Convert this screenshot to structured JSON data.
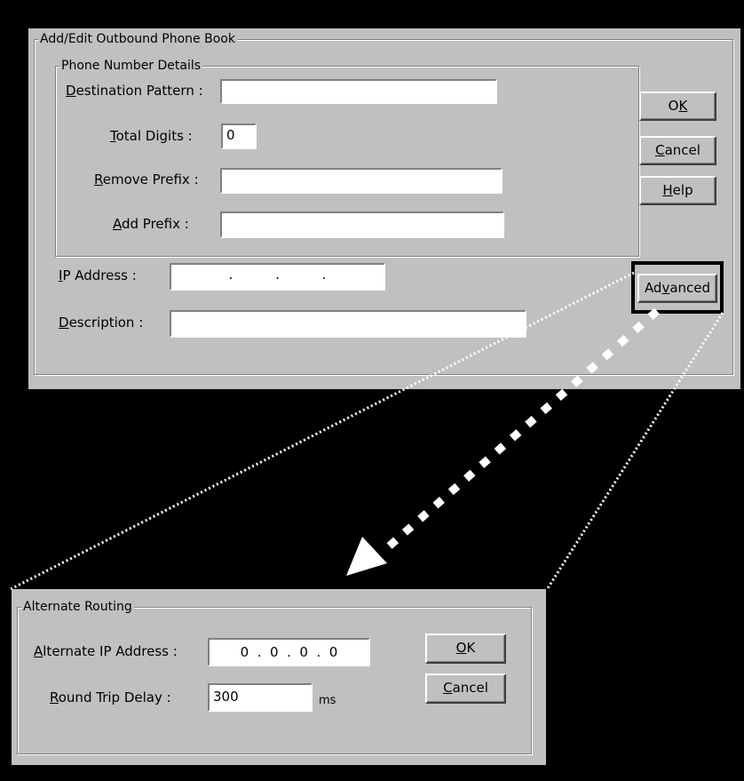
{
  "main_dialog": {
    "group_title": "Add/Edit Outbound Phone Book",
    "phone_group_title": "Phone Number Details",
    "destination_pattern": {
      "label_key": "D",
      "label_rest": "estination Pattern :",
      "value": ""
    },
    "total_digits": {
      "label_key": "T",
      "label_rest": "otal Digits :",
      "value": "0"
    },
    "remove_prefix": {
      "label_key": "R",
      "label_rest": "emove Prefix :",
      "value": ""
    },
    "add_prefix": {
      "label_key": "A",
      "label_rest": "dd Prefix :",
      "value": ""
    },
    "ip_address": {
      "label_key": "I",
      "label_rest": "P Address :",
      "value": ".          .          ."
    },
    "description": {
      "label_key": "D",
      "label_rest": "escription :",
      "value": ""
    },
    "ok": {
      "pre": "O",
      "key": "K",
      "post": ""
    },
    "cancel": {
      "pre": "",
      "key": "C",
      "post": "ancel"
    },
    "help": {
      "pre": "",
      "key": "H",
      "post": "elp"
    },
    "advanced": {
      "pre": "Ad",
      "key": "v",
      "post": "anced"
    }
  },
  "alt_dialog": {
    "group_title": "Alternate Routing",
    "alt_ip": {
      "label_key": "A",
      "label_rest": "lternate IP Address :",
      "value": "0  .  0  .  0  .  0"
    },
    "round_trip": {
      "label_key": "R",
      "label_rest": "ound Trip Delay :",
      "value": "300",
      "unit": "ms"
    },
    "ok": {
      "pre": "",
      "key": "O",
      "post": "K"
    },
    "cancel": {
      "pre": "",
      "key": "C",
      "post": "ancel"
    }
  },
  "colors": {
    "dialog_bg": "#c0c0c0",
    "background": "#000000",
    "highlight_border": "#000000",
    "connector": "#ffffff"
  }
}
